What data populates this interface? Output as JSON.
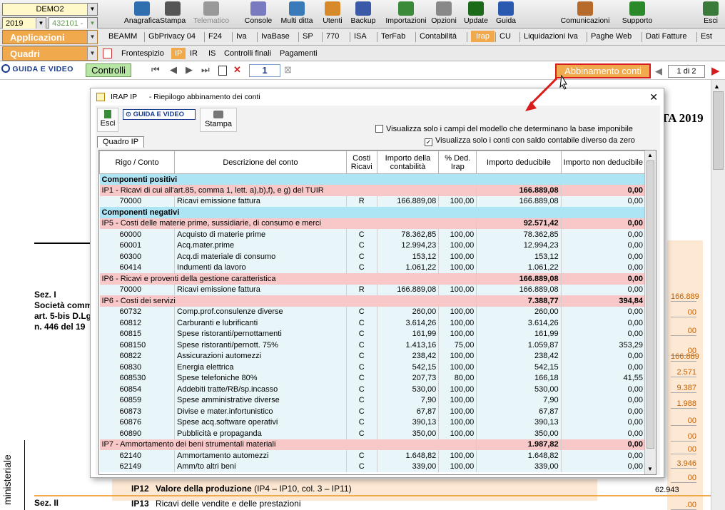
{
  "toolbar": {
    "company": "DEMO2",
    "year": "2019",
    "code": "432101 -",
    "buttons": [
      "Anagrafica",
      "Stampa",
      "Telematico",
      "Console",
      "Multi ditta",
      "Utenti",
      "Backup",
      "Importazioni",
      "Opzioni",
      "Update",
      "Guida",
      "Comunicazioni",
      "Supporto",
      "Esci"
    ]
  },
  "menu": {
    "applicazioni": "Applicazioni",
    "quadri": "Quadri",
    "tabs": [
      "BEAMM",
      "GbPrivacy 04",
      "F24",
      "Iva",
      "IvaBase",
      "SP",
      "770",
      "ISA",
      "TerFab",
      "Contabilità",
      "Irap",
      "CU",
      "Liquidazioni Iva",
      "Paghe Web",
      "Dati Fatture",
      "Est"
    ],
    "subtabs": [
      "Frontespizio",
      "IP",
      "IR",
      "IS",
      "Controlli finali",
      "Pagamenti"
    ]
  },
  "nav": {
    "guida": "GUIDA E VIDEO",
    "controlli": "Controlli",
    "page": "1",
    "abbinamento": "Abbinamento conti",
    "pagecount": "1 di 2"
  },
  "background": {
    "year": "TA 2019",
    "sez1": "Sez. I",
    "soc": "Società comm",
    "art": "art. 5-bis D.Lg",
    "n": "n. 446 del 19",
    "ip12": "IP12",
    "ip12t": "Valore della produzione",
    "ip12s": "(IP4 – IP10, col. 3 – IP11)",
    "ip12v": "62.943",
    "ip13": "IP13",
    "ip13t": "Ricavi delle vendite e delle prestazioni",
    "sez2": "Sez. II",
    "mini": "ministeriale",
    "rvals": [
      "166.889",
      "00",
      "00",
      "00",
      "166.889",
      "2.571",
      "9.387",
      "1.988",
      "00",
      "00",
      "00",
      "3.946",
      "00",
      ".00"
    ]
  },
  "dialog": {
    "title": "IRAP IP",
    "subtitle": "- Riepilogo abbinamento dei conti",
    "esci": "Esci",
    "guida": "GUIDA E VIDEO",
    "stampa": "Stampa",
    "quadro": "Quadro IP",
    "opt1": "Visualizza solo i campi del modello che determinano la base imponibile",
    "opt2": "Visualizza solo i conti con saldo contabile diverso da zero",
    "columns": [
      "Rigo / Conto",
      "Descrizione del conto",
      "Costi Ricavi",
      "Importo della contabilità",
      "% Ded. Irap",
      "Importo deducibile",
      "Importo non deducibile"
    ],
    "rows": [
      {
        "t": "hdr",
        "d": "Componenti positivi"
      },
      {
        "t": "grp",
        "d": "IP1 - Ricavi di cui all'art.85, comma 1, lett. a),b),f), e g) del TUIR",
        "ded": "166.889,08",
        "nd": "0,00"
      },
      {
        "t": "row",
        "c": "70000",
        "d": "Ricavi emissione fattura",
        "cr": "R",
        "imp": "166.889,08",
        "p": "100,00",
        "ded": "166.889,08",
        "nd": "0,00"
      },
      {
        "t": "hdr",
        "d": "Componenti negativi"
      },
      {
        "t": "grp",
        "d": "IP5 - Costi delle materie prime, sussidiarie, di consumo e merci",
        "ded": "92.571,42",
        "nd": "0,00"
      },
      {
        "t": "row",
        "c": "60000",
        "d": "Acquisto di materie prime",
        "cr": "C",
        "imp": "78.362,85",
        "p": "100,00",
        "ded": "78.362,85",
        "nd": "0,00"
      },
      {
        "t": "row",
        "c": "60001",
        "d": "Acq.mater.prime",
        "cr": "C",
        "imp": "12.994,23",
        "p": "100,00",
        "ded": "12.994,23",
        "nd": "0,00"
      },
      {
        "t": "row",
        "c": "60300",
        "d": "Acq.di materiale di consumo",
        "cr": "C",
        "imp": "153,12",
        "p": "100,00",
        "ded": "153,12",
        "nd": "0,00"
      },
      {
        "t": "row",
        "c": "60414",
        "d": "Indumenti da lavoro",
        "cr": "C",
        "imp": "1.061,22",
        "p": "100,00",
        "ded": "1.061,22",
        "nd": "0,00"
      },
      {
        "t": "grp",
        "d": "IP6 - Ricavi e proventi della gestione caratteristica",
        "ded": "166.889,08",
        "nd": "0,00"
      },
      {
        "t": "row",
        "c": "70000",
        "d": "Ricavi emissione fattura",
        "cr": "R",
        "imp": "166.889,08",
        "p": "100,00",
        "ded": "166.889,08",
        "nd": "0,00"
      },
      {
        "t": "grp",
        "d": "IP6 - Costi dei servizi",
        "ded": "7.388,77",
        "nd": "394,84"
      },
      {
        "t": "row",
        "c": "60732",
        "d": "Comp.prof.consulenze diverse",
        "cr": "C",
        "imp": "260,00",
        "p": "100,00",
        "ded": "260,00",
        "nd": "0,00"
      },
      {
        "t": "row",
        "c": "60812",
        "d": "Carburanti e lubrificanti",
        "cr": "C",
        "imp": "3.614,26",
        "p": "100,00",
        "ded": "3.614,26",
        "nd": "0,00"
      },
      {
        "t": "row",
        "c": "60815",
        "d": "Spese ristoranti/pernottamenti",
        "cr": "C",
        "imp": "161,99",
        "p": "100,00",
        "ded": "161,99",
        "nd": "0,00"
      },
      {
        "t": "row",
        "c": "608150",
        "d": "Spese ristoranti/pernott. 75%",
        "cr": "C",
        "imp": "1.413,16",
        "p": "75,00",
        "ded": "1.059,87",
        "nd": "353,29"
      },
      {
        "t": "row",
        "c": "60822",
        "d": "Assicurazioni automezzi",
        "cr": "C",
        "imp": "238,42",
        "p": "100,00",
        "ded": "238,42",
        "nd": "0,00"
      },
      {
        "t": "row",
        "c": "60830",
        "d": "Energia elettrica",
        "cr": "C",
        "imp": "542,15",
        "p": "100,00",
        "ded": "542,15",
        "nd": "0,00"
      },
      {
        "t": "row",
        "c": "608530",
        "d": "Spese telefoniche 80%",
        "cr": "C",
        "imp": "207,73",
        "p": "80,00",
        "ded": "166,18",
        "nd": "41,55"
      },
      {
        "t": "row",
        "c": "60854",
        "d": "Addebiti tratte/RB/sp.incasso",
        "cr": "C",
        "imp": "530,00",
        "p": "100,00",
        "ded": "530,00",
        "nd": "0,00"
      },
      {
        "t": "row",
        "c": "60859",
        "d": "Spese amministrative diverse",
        "cr": "C",
        "imp": "7,90",
        "p": "100,00",
        "ded": "7,90",
        "nd": "0,00"
      },
      {
        "t": "row",
        "c": "60873",
        "d": "Divise e mater.infortunistico",
        "cr": "C",
        "imp": "67,87",
        "p": "100,00",
        "ded": "67,87",
        "nd": "0,00"
      },
      {
        "t": "row",
        "c": "60876",
        "d": "Spese acq.software operativi",
        "cr": "C",
        "imp": "390,13",
        "p": "100,00",
        "ded": "390,13",
        "nd": "0,00"
      },
      {
        "t": "row",
        "c": "60890",
        "d": "Pubblicità e propaganda",
        "cr": "C",
        "imp": "350,00",
        "p": "100,00",
        "ded": "350,00",
        "nd": "0,00"
      },
      {
        "t": "grp",
        "d": "IP7 - Ammortamento dei beni strumentali materiali",
        "ded": "1.987,82",
        "nd": "0,00"
      },
      {
        "t": "row",
        "c": "62140",
        "d": "Ammortamento automezzi",
        "cr": "C",
        "imp": "1.648,82",
        "p": "100,00",
        "ded": "1.648,82",
        "nd": "0,00"
      },
      {
        "t": "row",
        "c": "62149",
        "d": "Amm/to altri beni",
        "cr": "C",
        "imp": "339,00",
        "p": "100,00",
        "ded": "339,00",
        "nd": "0,00"
      }
    ]
  }
}
